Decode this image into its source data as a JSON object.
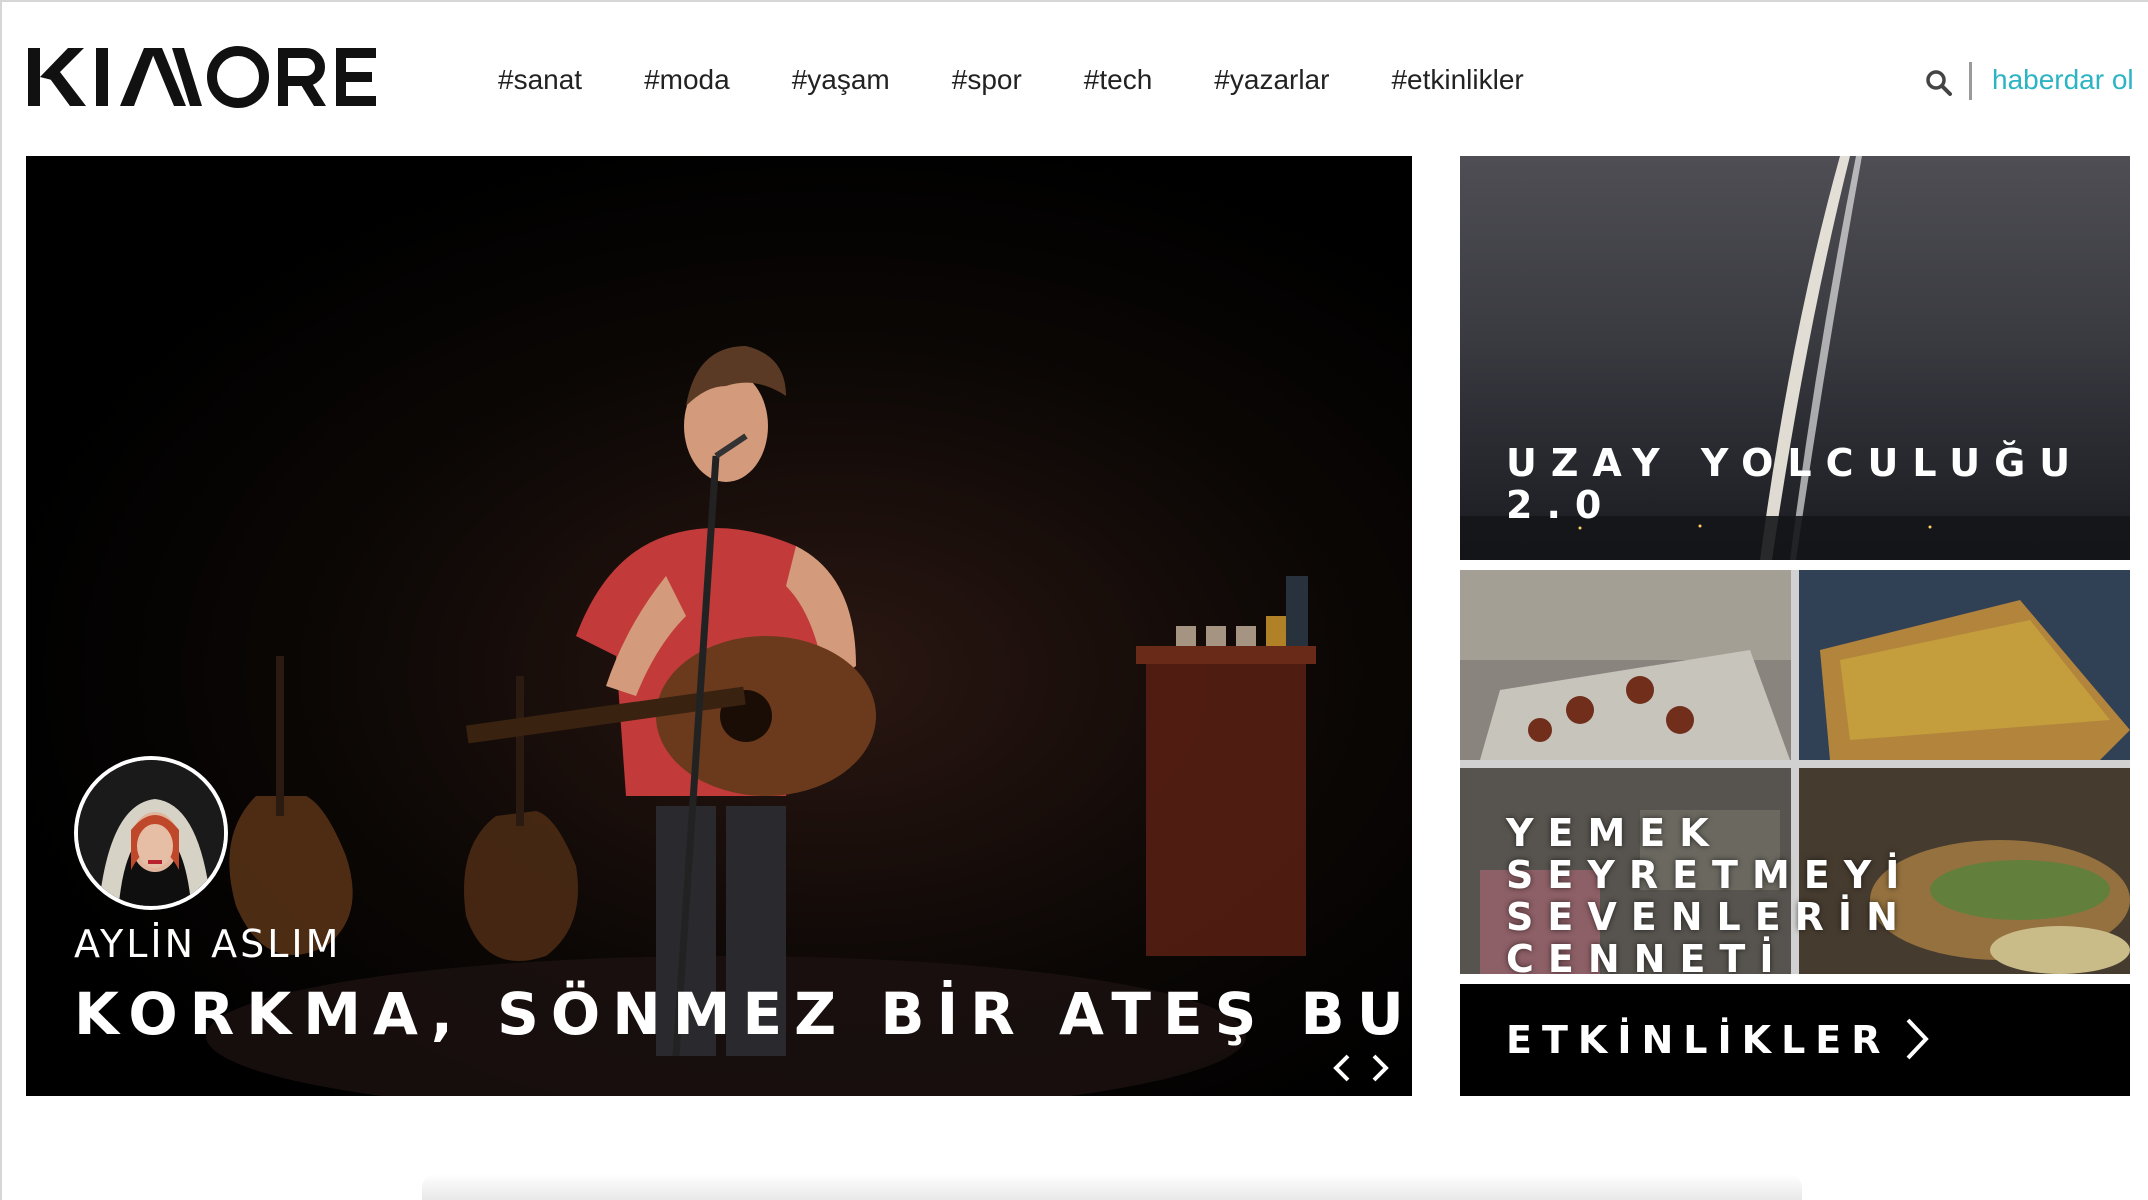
{
  "header": {
    "logo_text": "KIMORE",
    "nav": [
      {
        "label": "#sanat"
      },
      {
        "label": "#moda"
      },
      {
        "label": "#yaşam"
      },
      {
        "label": "#spor"
      },
      {
        "label": "#tech"
      },
      {
        "label": "#yazarlar"
      },
      {
        "label": "#etkinlikler"
      }
    ],
    "search_icon": "search-icon",
    "subscribe_label": "haberdar ol"
  },
  "hero": {
    "author": "AYLİN ASLIM",
    "title": "KORKMA, SÖNMEZ BİR ATEŞ BU",
    "prev_icon": "chevron-left-icon",
    "next_icon": "chevron-right-icon"
  },
  "side_cards": [
    {
      "title_line1": "UZAY YOLCULUĞU",
      "title_line2": "2.0"
    },
    {
      "title_line1": "YEMEK SEYRETMEYİ",
      "title_line2": "SEVENLERİN",
      "title_line3": "CENNETİ"
    }
  ],
  "events": {
    "label": "ETKİNLİKLER",
    "icon": "chevron-right-icon"
  },
  "colors": {
    "accent": "#2cb4c4",
    "text": "#222222",
    "dark": "#000000"
  }
}
